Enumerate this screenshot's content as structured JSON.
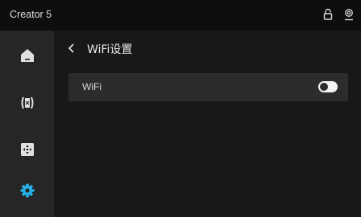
{
  "window": {
    "title": "Creator 5"
  },
  "header_icons": [
    "lock-icon",
    "user-icon"
  ],
  "sidebar": {
    "items": [
      {
        "id": "home",
        "icon": "home-icon",
        "active": false
      },
      {
        "id": "print-head",
        "icon": "extruder-icon",
        "active": false
      },
      {
        "id": "move",
        "icon": "move-control-icon",
        "active": false
      },
      {
        "id": "settings",
        "icon": "gear-icon",
        "active": true
      }
    ]
  },
  "page": {
    "back_icon": "chevron-left-icon",
    "title": "WiFi设置"
  },
  "settings": {
    "wifi": {
      "label": "WiFi",
      "enabled": false
    }
  },
  "colors": {
    "accent": "#29b2e8",
    "icon": "#e0e0e0",
    "toggle_track": "#f2f2f2"
  }
}
